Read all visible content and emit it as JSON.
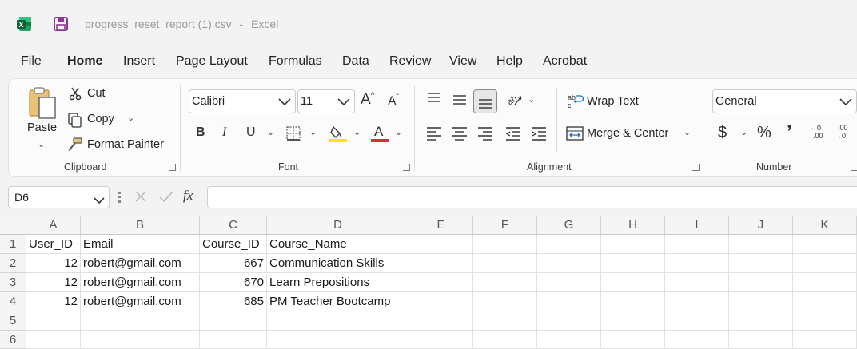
{
  "title": {
    "filename": "progress_reset_report (1).csv",
    "separator": "-",
    "app": "Excel"
  },
  "menu": [
    "File",
    "Home",
    "Insert",
    "Page Layout",
    "Formulas",
    "Data",
    "Review",
    "View",
    "Help",
    "Acrobat"
  ],
  "menu_active": "Home",
  "clipboard": {
    "paste": "Paste",
    "cut": "Cut",
    "copy": "Copy",
    "format_painter": "Format Painter",
    "label": "Clipboard"
  },
  "font": {
    "family": "Calibri",
    "size": "11",
    "bold": "B",
    "italic": "I",
    "underline": "U",
    "color_letter": "A",
    "grow": "A",
    "shrink": "A",
    "label": "Font",
    "highlight_color": "#ffe600",
    "font_color": "#d13438"
  },
  "alignment": {
    "wrap_text": "Wrap Text",
    "merge_center": "Merge & Center",
    "label": "Alignment"
  },
  "number": {
    "format": "General",
    "currency": "$",
    "percent": "%",
    "comma": "’",
    "increase_decimal": ".00",
    "decrease_decimal": ".00",
    "label": "Number"
  },
  "formula_bar": {
    "name_box": "D6",
    "fx": "fx",
    "content": ""
  },
  "columns": [
    "A",
    "B",
    "C",
    "D",
    "E",
    "F",
    "G",
    "H",
    "I",
    "J",
    "K"
  ],
  "rows": [
    "1",
    "2",
    "3",
    "4",
    "5",
    "6"
  ],
  "sheet": {
    "headers": [
      "User_ID",
      "Email",
      "Course_ID",
      "Course_Name"
    ],
    "data": [
      [
        "12",
        "robert@gmail.com",
        "667",
        "Communication Skills"
      ],
      [
        "12",
        "robert@gmail.com",
        "670",
        "Learn Prepositions"
      ],
      [
        "12",
        "robert@gmail.com",
        "685",
        "PM Teacher Bootcamp"
      ]
    ]
  },
  "icons": {
    "excel": "excel-logo-icon",
    "save": "save-icon",
    "cut": "scissors-icon",
    "copy": "copy-icon",
    "format_painter": "paintbrush-icon"
  },
  "colors": {
    "excel_green": "#107c41",
    "save_purple": "#8b3a8f",
    "ribbon_bg": "#fbfbfb",
    "window_bg": "#f3f3f3"
  }
}
